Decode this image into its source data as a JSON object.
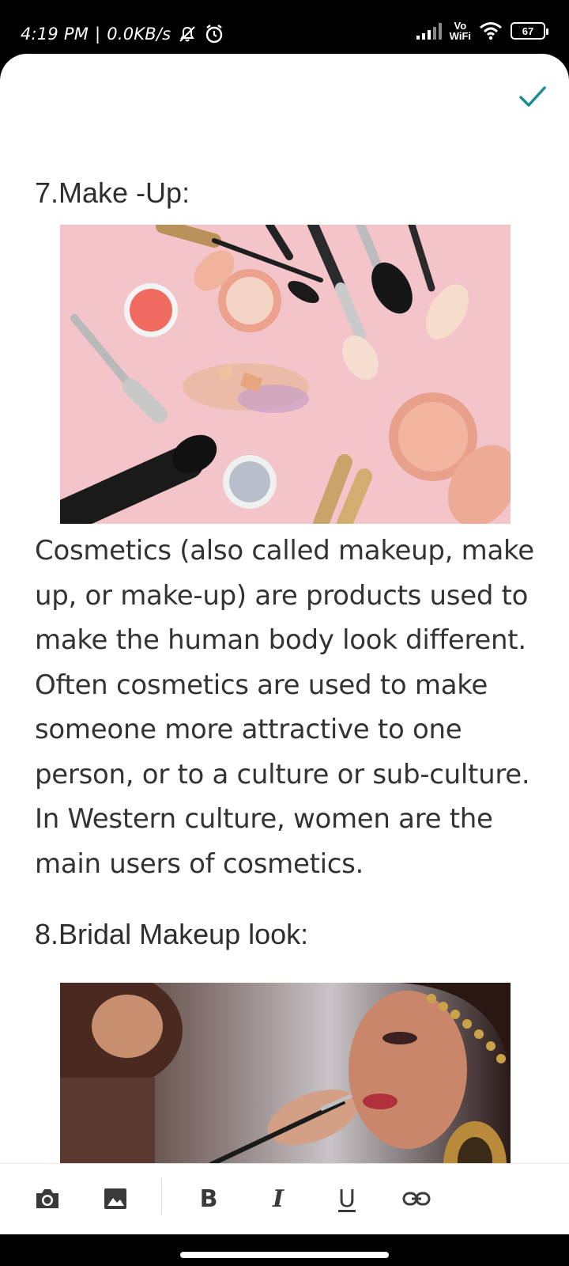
{
  "status_bar": {
    "time": "4:19 PM",
    "separator": "|",
    "net_speed": "0.0KB/s",
    "vowifi_top": "Vo",
    "vowifi_bottom": "WiFi",
    "battery_level": "67"
  },
  "document": {
    "section1_heading": "7.Make -Up:",
    "section1_image_icon": "makeup-products-photo",
    "section1_paragraph": "Cosmetics (also called makeup, make up, or make-up) are products used to make the human body look different. Often cosmetics are used to make someone more attractive to one person, or to a culture or sub-culture. In Western culture, women are the main users of cosmetics.",
    "section2_heading": "8.Bridal Makeup look:",
    "section2_image_icon": "bridal-makeup-photo"
  },
  "toolbar": {
    "bold_label": "B",
    "italic_label": "I",
    "underline_label": "U"
  },
  "colors": {
    "accent": "#1f8a9a",
    "text": "#333333"
  }
}
